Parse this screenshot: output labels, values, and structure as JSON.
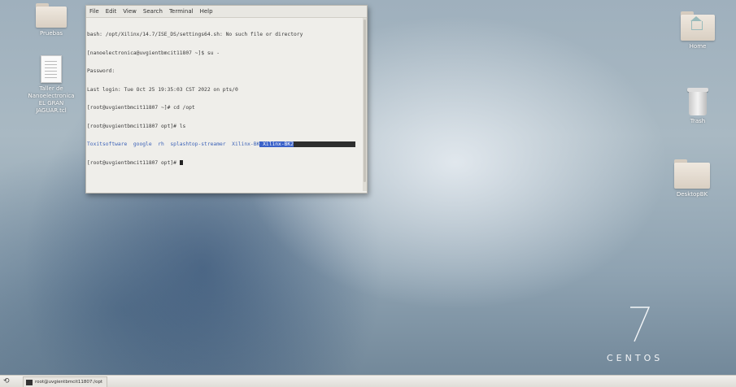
{
  "desktop": {
    "icons": [
      {
        "name": "Pruebas",
        "type": "folder"
      },
      {
        "name": "Taller de Nanoelectronica EL GRAN JAGUAR.tcl",
        "type": "document"
      },
      {
        "name": "Home",
        "type": "home-folder"
      },
      {
        "name": "Trash",
        "type": "trash"
      },
      {
        "name": "DesktopBK",
        "type": "folder"
      }
    ]
  },
  "terminal": {
    "menu": [
      "File",
      "Edit",
      "View",
      "Search",
      "Terminal",
      "Help"
    ],
    "lines": [
      "bash: /opt/Xilinx/14.7/ISE_DS/settings64.sh: No such file or directory",
      "[nanoelectronica@uvgientbmcit11807 ~]$ su -",
      "Password:",
      "Last login: Tue Oct 25 19:35:03 CST 2022 on pts/0",
      "[root@uvgientbmcit11807 ~]# cd /opt",
      "[root@uvgientbmcit11807 opt]# ls"
    ],
    "ls_output": {
      "plain": "Toxitsoftware  google  rh  splashtop-streamer  Xilinx-BK",
      "highlight": " Xilinx-BK2"
    },
    "prompt": "[root@uvgientbmcit11807 opt]# "
  },
  "branding": {
    "version_number": "7",
    "word": "CENTOS"
  },
  "taskbar": {
    "launcher_icon": "taskbar-launcher-icon",
    "window_item": "root@uvgientbmcit11807:/opt"
  },
  "colors": {
    "terminal_blue": "#3d63b8",
    "selection": "#3b62c9"
  }
}
